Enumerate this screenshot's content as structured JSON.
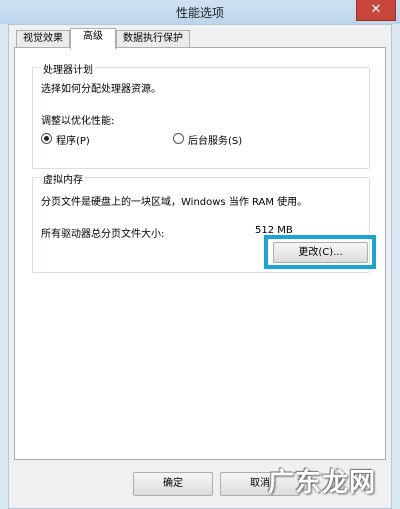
{
  "window": {
    "title": "性能选项",
    "close_label": "✕"
  },
  "tabs": [
    {
      "label": "视觉效果"
    },
    {
      "label": "高级",
      "active": true
    },
    {
      "label": "数据执行保护"
    }
  ],
  "processor": {
    "group_label": "处理器计划",
    "description": "选择如何分配处理器资源。",
    "prompt": "调整以优化性能:",
    "options": [
      {
        "label": "程序(P)",
        "selected": true
      },
      {
        "label": "后台服务(S)",
        "selected": false
      }
    ]
  },
  "virtual_memory": {
    "group_label": "虚拟内存",
    "description": "分页文件是硬盘上的一块区域，Windows 当作 RAM 使用。",
    "total_label": "所有驱动器总分页文件大小:",
    "total_value": "512 MB",
    "change_button": "更改(C)..."
  },
  "footer": {
    "ok_label": "确定",
    "cancel_label": "取消"
  },
  "watermark": "广东龙网",
  "colors": {
    "highlight": "#1aa3d8",
    "close_button": "#c7463a"
  }
}
